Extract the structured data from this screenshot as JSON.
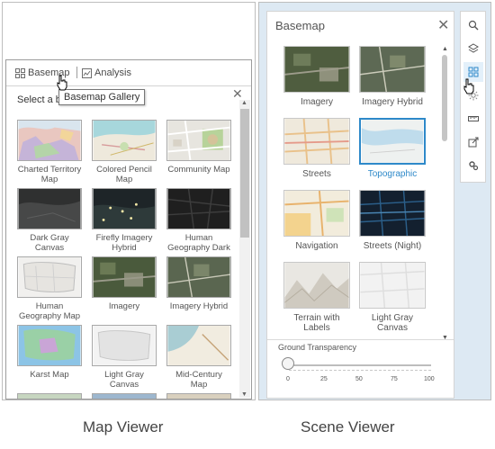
{
  "map_viewer": {
    "tabs": [
      {
        "label": "Basemap",
        "icon": "basemap-grid-icon"
      },
      {
        "label": "Analysis",
        "icon": "analysis-icon"
      }
    ],
    "select_text": "Select a b",
    "tooltip": "Basemap Gallery",
    "tiles": [
      {
        "label": "Charted Territory Map"
      },
      {
        "label": "Colored Pencil Map"
      },
      {
        "label": "Community Map"
      },
      {
        "label": "Dark Gray Canvas"
      },
      {
        "label": "Firefly Imagery Hybrid"
      },
      {
        "label": "Human Geography Dark"
      },
      {
        "label": "Human Geography Map"
      },
      {
        "label": "Imagery"
      },
      {
        "label": "Imagery Hybrid"
      },
      {
        "label": "Karst Map"
      },
      {
        "label": "Light Gray Canvas"
      },
      {
        "label": "Mid-Century Map"
      }
    ]
  },
  "scene_viewer": {
    "title": "Basemap",
    "tiles": [
      {
        "label": "Imagery"
      },
      {
        "label": "Imagery Hybrid"
      },
      {
        "label": "Streets"
      },
      {
        "label": "Topographic",
        "selected": true
      },
      {
        "label": "Navigation"
      },
      {
        "label": "Streets (Night)"
      },
      {
        "label": "Terrain with Labels"
      },
      {
        "label": "Light Gray Canvas"
      }
    ],
    "ground_transparency": {
      "label": "Ground Transparency",
      "value": 0,
      "ticks": [
        "0",
        "25",
        "50",
        "75",
        "100"
      ]
    },
    "sidebar_icons": [
      "search-icon",
      "layers-icon",
      "basemap-icon",
      "sun-icon",
      "measure-icon",
      "share-icon",
      "settings-icon"
    ],
    "accent": "#2e89c9"
  },
  "captions": {
    "left": "Map Viewer",
    "right": "Scene Viewer"
  }
}
